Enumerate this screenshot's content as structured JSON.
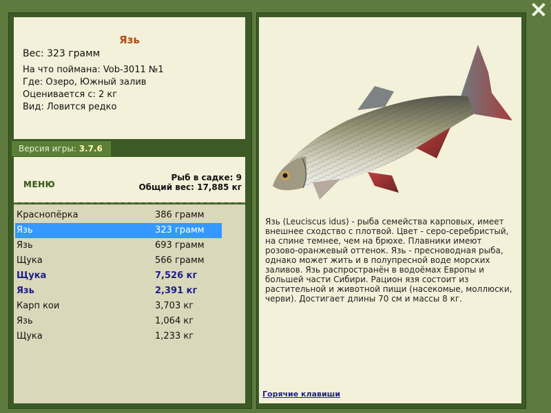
{
  "fish": {
    "title": "Язь",
    "weight": "Вес: 323 грамм",
    "details": [
      "На что поймана: Vob-3011 №1",
      "Где: Озеро, Южный залив",
      "Оценивается с: 2 кг",
      "Вид: Ловится редко"
    ]
  },
  "version": {
    "label": "Версия игры: ",
    "value": "3.7.6"
  },
  "menu_label": "МЕНЮ",
  "stats": {
    "count": "Рыб в садке: 9",
    "total": "Общий вес: 17,885 кг"
  },
  "catch_list": [
    {
      "name": "Краснопёрка",
      "weight": "386 грамм",
      "style": "normal"
    },
    {
      "name": "Язь",
      "weight": "323 грамм",
      "style": "selected"
    },
    {
      "name": "Язь",
      "weight": "693 грамм",
      "style": "normal"
    },
    {
      "name": "Щука",
      "weight": "566 грамм",
      "style": "normal"
    },
    {
      "name": "Щука",
      "weight": "7,526 кг",
      "style": "big"
    },
    {
      "name": "Язь",
      "weight": "2,391 кг",
      "style": "big"
    },
    {
      "name": "Карп кои",
      "weight": "3,703 кг",
      "style": "normal"
    },
    {
      "name": "Язь",
      "weight": "1,064 кг",
      "style": "normal"
    },
    {
      "name": "Щука",
      "weight": "1,233 кг",
      "style": "normal"
    }
  ],
  "description": "Язь (Leuciscus idus) - рыба семейства карповых, имеет внешнее сходство с плотвой. Цвет - серо-серебристый, на спине темнее, чем на брюхе. Плавники имеют розово-оранжевый оттенок. Язь - пресноводная рыба, однако может жить и в полупресной воде морских заливов. Язь распространён в водоёмах Европы и большей части Сибири. Рацион язя состоит из растительной и животной пищи (насекомые, моллюски, черви). Достигает длины 70 см и массы 8 кг.",
  "hotkeys_label": "Горячие клавиши",
  "icons": {
    "close": "close-icon",
    "fish_image": "ide-fish-image"
  },
  "colors": {
    "background": "#5e7a3e",
    "parchment": "#f3f1d9",
    "list_bg": "#dad8ba",
    "title": "#b14b12",
    "selection": "#3399ff",
    "highlight_text": "#1c1c8a"
  }
}
